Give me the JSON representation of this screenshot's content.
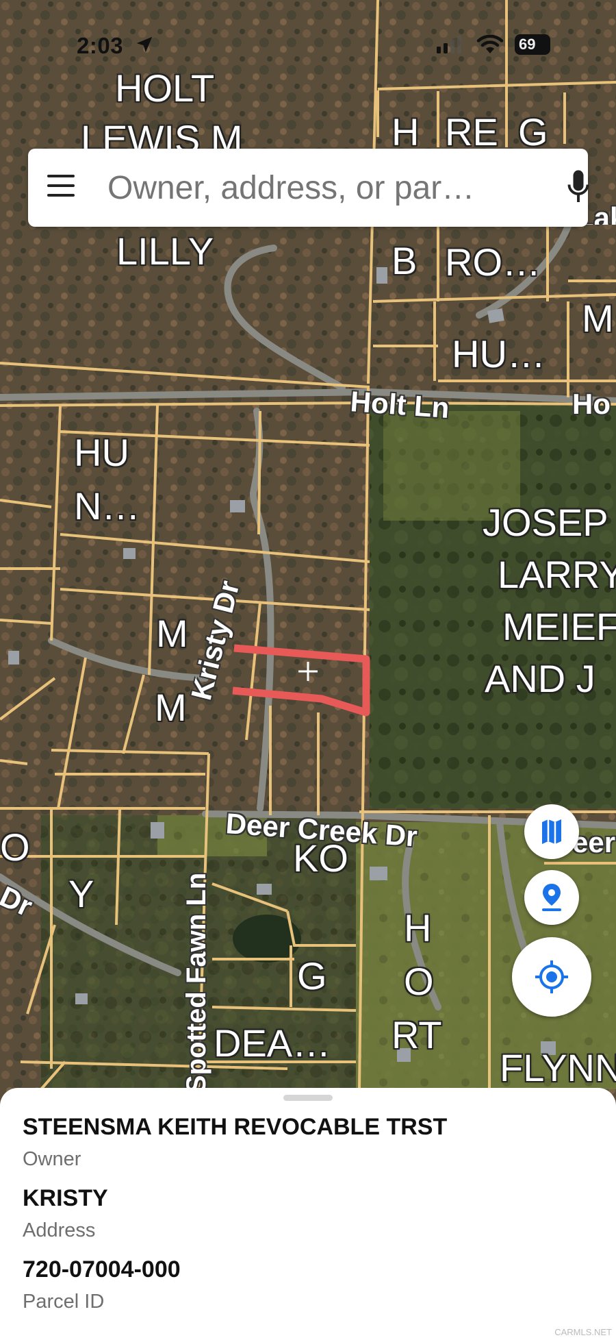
{
  "status_bar": {
    "time": "2:03",
    "battery": "69"
  },
  "search": {
    "placeholder": "Owner, address, or par…"
  },
  "map": {
    "parcel_labels": [
      "HOLT",
      "LEWIS M",
      "LILLY",
      "H",
      "RE",
      "G",
      "B",
      "RO…",
      "M",
      "HU…",
      "HU",
      "N…",
      "JOSEP",
      "LARRY",
      "MEIEF",
      "AND J",
      "M",
      "M",
      "O",
      "Y",
      "KO",
      "H",
      "O",
      "RT",
      "G",
      "DEA…",
      "FLYNN",
      "Dr"
    ],
    "street_labels": {
      "holt_ln": "Holt Ln",
      "holt_ln_2": "Ho",
      "kristy_dr": "Kristy Dr",
      "deer_creek_dr": "Deer Creek Dr",
      "deer_creek_dr_2": "eer",
      "spotted_fawn_ln": "Spotted Fawn Ln",
      "lake_partial": "Lake"
    },
    "selected_parcel_color": "#e85a57",
    "parcel_line_color": "#e8c27a"
  },
  "controls": {
    "layers_icon": "map-layers-icon",
    "pin_icon": "location-pin-icon",
    "locate_icon": "my-location-icon"
  },
  "parcel_info": {
    "owner": "STEENSMA KEITH REVOCABLE TRST",
    "owner_label": "Owner",
    "address": "KRISTY",
    "address_label": "Address",
    "parcel_id": "720-07004-000",
    "parcel_id_label": "Parcel ID"
  },
  "watermark": "CARMLS.NET"
}
